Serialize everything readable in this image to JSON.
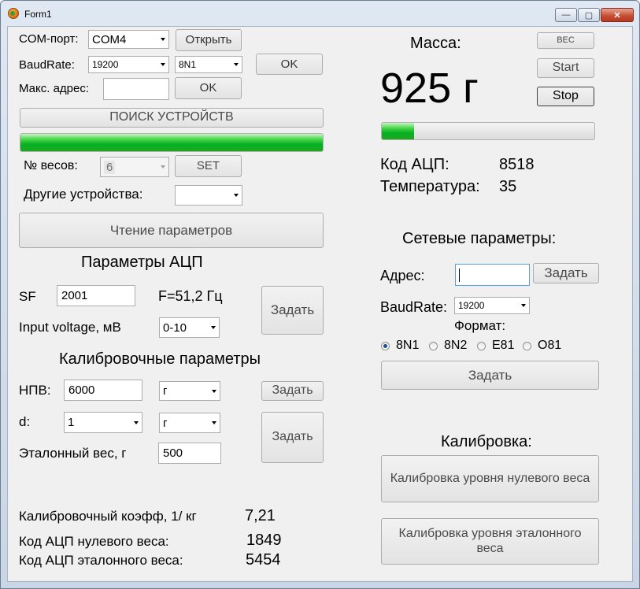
{
  "window": {
    "title": "Form1",
    "minimize_glyph": "—",
    "maximize_glyph": "▢",
    "close_glyph": "✕"
  },
  "left": {
    "com_port_label": "COM-порт:",
    "com_port_value": "COM4",
    "open_button": "Открыть",
    "baudrate_label": "BaudRate:",
    "baudrate_value": "19200",
    "format_value": "8N1",
    "ok_button_1": "OK",
    "max_address_label": "Макс. адрес:",
    "max_address_value": "",
    "ok_button_2": "OK",
    "search_button": "ПОИСК УСТРОЙСТВ",
    "search_progress": 1.0,
    "scale_no_label": "№ весов:",
    "scale_no_value": "6",
    "set_button": "SET",
    "other_devices_label": "Другие устройства:",
    "other_devices_value": "",
    "read_params_button": "Чтение параметров",
    "adc_params_heading": "Параметры АЦП",
    "sf_label": "SF",
    "sf_value": "2001",
    "freq_label": "F=51,2 Гц",
    "input_voltage_label": "Input voltage, мВ",
    "input_voltage_value": "0-10",
    "set_adc_button": "Задать",
    "calib_params_heading": "Калибровочные параметры",
    "npv_label": "НПВ:",
    "npv_value": "6000",
    "npv_unit": "г",
    "set_npv_button": "Задать",
    "d_label": "d:",
    "d_value": "1",
    "d_unit": "г",
    "set_d_button": "Задать",
    "ref_weight_label": "Эталонный вес, г",
    "ref_weight_value": "500",
    "calib_coeff_label": "Калибровочный коэфф, 1/ кг",
    "calib_coeff_value": "7,21",
    "adc_zero_label": "Код АЦП нулевого веса:",
    "adc_zero_value": "1849",
    "adc_ref_label": "Код АЦП эталонного веса:",
    "adc_ref_value": "5454"
  },
  "right": {
    "mass_label": "Масса:",
    "ves_button": "ВЕС",
    "start_button": "Start",
    "stop_button": "Stop",
    "mass_value": "925 г",
    "mass_progress": 0.15,
    "adc_code_label": "Код АЦП:",
    "adc_code_value": "8518",
    "temp_label": "Температура:",
    "temp_value": "35",
    "network_heading": "Сетевые параметры:",
    "address_label": "Адрес:",
    "address_value": "",
    "set_address_button": "Задать",
    "baudrate_label": "BaudRate:",
    "baudrate_value": "19200",
    "format_label": "Формат:",
    "formats": [
      "8N1",
      "8N2",
      "E81",
      "O81"
    ],
    "format_selected": "8N1",
    "set_network_button": "Задать",
    "calibration_heading": "Калибровка:",
    "calib_zero_button": "Калибровка уровня нулевого веса",
    "calib_ref_button": "Калибровка уровня эталонного веса"
  },
  "colors": {
    "progress_green": "#06b025",
    "window_frame": "#c9d6e5",
    "client_bg": "#f0f0f0"
  }
}
